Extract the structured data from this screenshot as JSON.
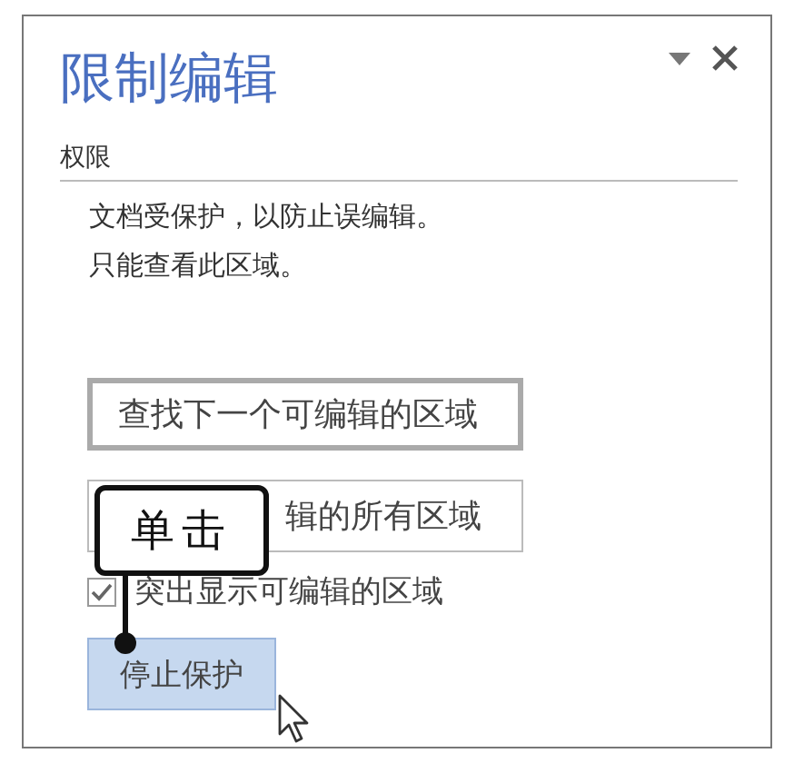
{
  "pane": {
    "title": "限制编辑",
    "section": "权限",
    "message": [
      "文档受保护，以防止误编辑。",
      "只能查看此区域。"
    ]
  },
  "buttons": [
    {
      "label": "查找下一个可编辑的区域"
    },
    {
      "label": "辑的所有区域"
    }
  ],
  "checkbox": {
    "label": "突出显示可编辑的区域",
    "checked": true
  },
  "stop_button": {
    "label": "停止保护"
  },
  "callout": {
    "text": "单击"
  }
}
